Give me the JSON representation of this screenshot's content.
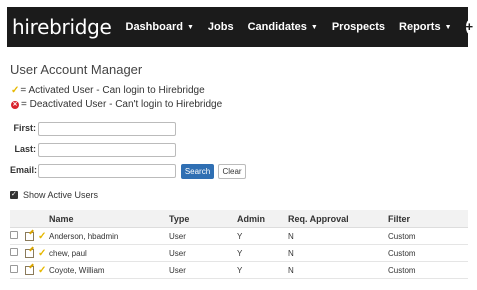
{
  "nav": {
    "logo": "hirebridge",
    "items": [
      {
        "label": "Dashboard",
        "caret": true
      },
      {
        "label": "Jobs",
        "caret": false
      },
      {
        "label": "Candidates",
        "caret": true
      },
      {
        "label": "Prospects",
        "caret": false
      },
      {
        "label": "Reports",
        "caret": true
      }
    ],
    "plus_icon": "plus-circle-icon"
  },
  "page": {
    "title": "User Account Manager",
    "legend_activated": "= Activated User - Can login to Hirebridge",
    "legend_deactivated": "= Deactivated User - Can't login to Hirebridge"
  },
  "form": {
    "first_label": "First:",
    "first_value": "",
    "last_label": "Last:",
    "last_value": "",
    "email_label": "Email:",
    "email_value": "",
    "search_label": "Search",
    "clear_label": "Clear",
    "show_active_label": "Show Active Users",
    "show_active_checked": true
  },
  "table": {
    "headers": {
      "name": "Name",
      "type": "Type",
      "admin": "Admin",
      "req_approval": "Req. Approval",
      "filter": "Filter"
    },
    "rows": [
      {
        "name": "Anderson, hbadmin",
        "type": "User",
        "admin": "Y",
        "req_approval": "N",
        "filter": "Custom"
      },
      {
        "name": "chew, paul",
        "type": "User",
        "admin": "Y",
        "req_approval": "N",
        "filter": "Custom"
      },
      {
        "name": "Coyote, William",
        "type": "User",
        "admin": "Y",
        "req_approval": "N",
        "filter": "Custom"
      }
    ]
  },
  "colors": {
    "navbar": "#1b1b1b",
    "accent": "#2f6fb3",
    "activated": "#e6b800",
    "deactivated": "#d9232d"
  }
}
